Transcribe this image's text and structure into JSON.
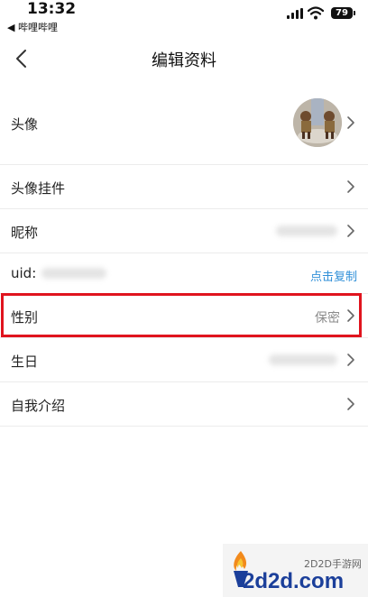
{
  "status_bar": {
    "time": "13:32",
    "back_app": "◀ 哔哩哔哩",
    "battery": "79"
  },
  "nav": {
    "title": "编辑资料"
  },
  "rows": {
    "avatar": {
      "label": "头像"
    },
    "pendant": {
      "label": "头像挂件"
    },
    "nickname": {
      "label": "昵称"
    },
    "uid": {
      "label": "uid:",
      "action": "点击复制"
    },
    "gender": {
      "label": "性别",
      "value": "保密"
    },
    "birthday": {
      "label": "生日"
    },
    "intro": {
      "label": "自我介绍"
    }
  },
  "watermark": {
    "site": "2D2D手游网",
    "domain": "2d2d.com"
  },
  "colors": {
    "highlight": "#e0141e",
    "link": "#2f8fd8"
  }
}
